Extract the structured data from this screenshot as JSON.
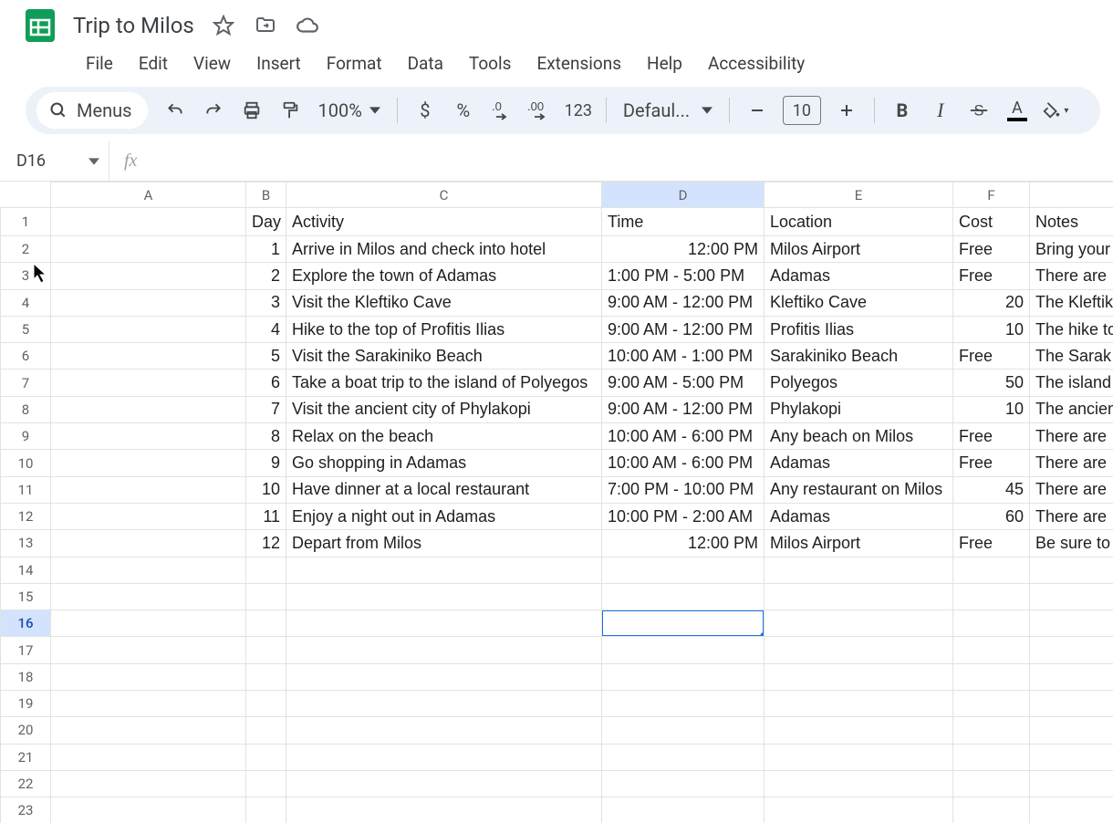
{
  "doc": {
    "title": "Trip to Milos"
  },
  "menus": [
    "File",
    "Edit",
    "View",
    "Insert",
    "Format",
    "Data",
    "Tools",
    "Extensions",
    "Help",
    "Accessibility"
  ],
  "toolbar": {
    "search_label": "Menus",
    "zoom": "100%",
    "font": "Defaul...",
    "font_size": "10",
    "number_format": "123"
  },
  "namebox": "D16",
  "columns": [
    "A",
    "B",
    "C",
    "D",
    "E",
    "F"
  ],
  "headers": {
    "B": "Day",
    "C": "Activity",
    "D": "Time",
    "E": "Location",
    "F": "Cost",
    "G": "Notes"
  },
  "rows": [
    {
      "n": 1,
      "day": "1",
      "activity": "Arrive in Milos and check into hotel",
      "time": "12:00 PM",
      "location": "Milos Airport",
      "cost": "Free",
      "notes": "Bring your"
    },
    {
      "n": 2,
      "day": "2",
      "activity": "Explore the town of Adamas",
      "time": "1:00 PM - 5:00 PM",
      "location": "Adamas",
      "cost": "Free",
      "notes": "There are"
    },
    {
      "n": 3,
      "day": "3",
      "activity": "Visit the Kleftiko Cave",
      "time": "9:00 AM - 12:00 PM",
      "location": "Kleftiko Cave",
      "cost": "20",
      "cost_align": "num",
      "notes": "The Kleftik"
    },
    {
      "n": 4,
      "day": "4",
      "activity": "Hike to the top of Profitis Ilias",
      "time": "9:00 AM - 12:00 PM",
      "location": "Profitis Ilias",
      "cost": "10",
      "cost_align": "num",
      "notes": "The hike to"
    },
    {
      "n": 5,
      "day": "5",
      "activity": "Visit the Sarakiniko Beach",
      "time": "10:00 AM - 1:00 PM",
      "location": "Sarakiniko Beach",
      "cost": "Free",
      "notes": "The Sarak"
    },
    {
      "n": 6,
      "day": "6",
      "activity": "Take a boat trip to the island of Polyegos",
      "time": "9:00 AM - 5:00 PM",
      "location": "Polyegos",
      "cost": "50",
      "cost_align": "num",
      "notes": "The island"
    },
    {
      "n": 7,
      "day": "7",
      "activity": "Visit the ancient city of Phylakopi",
      "time": "9:00 AM - 12:00 PM",
      "location": "Phylakopi",
      "cost": "10",
      "cost_align": "num",
      "notes": "The ancien"
    },
    {
      "n": 8,
      "day": "8",
      "activity": "Relax on the beach",
      "time": "10:00 AM - 6:00 PM",
      "location": "Any beach on Milos",
      "cost": "Free",
      "notes": "There are"
    },
    {
      "n": 9,
      "day": "9",
      "activity": "Go shopping in Adamas",
      "time": "10:00 AM - 6:00 PM",
      "location": "Adamas",
      "cost": "Free",
      "notes": "There are"
    },
    {
      "n": 10,
      "day": "10",
      "activity": "Have dinner at a local restaurant",
      "time": "7:00 PM - 10:00 PM",
      "location": "Any restaurant on Milos",
      "cost": "45",
      "cost_align": "num",
      "notes": "There are"
    },
    {
      "n": 11,
      "day": "11",
      "activity": "Enjoy a night out in Adamas",
      "time": "10:00 PM - 2:00 AM",
      "location": "Adamas",
      "cost": "60",
      "cost_align": "num",
      "notes": "There are"
    },
    {
      "n": 12,
      "day": "12",
      "activity": "Depart from Milos",
      "time": "12:00 PM",
      "location": "Milos Airport",
      "cost": "Free",
      "notes": "Be sure to"
    }
  ],
  "total_rows": 23,
  "active_cell": {
    "col": "D",
    "row": 16
  }
}
